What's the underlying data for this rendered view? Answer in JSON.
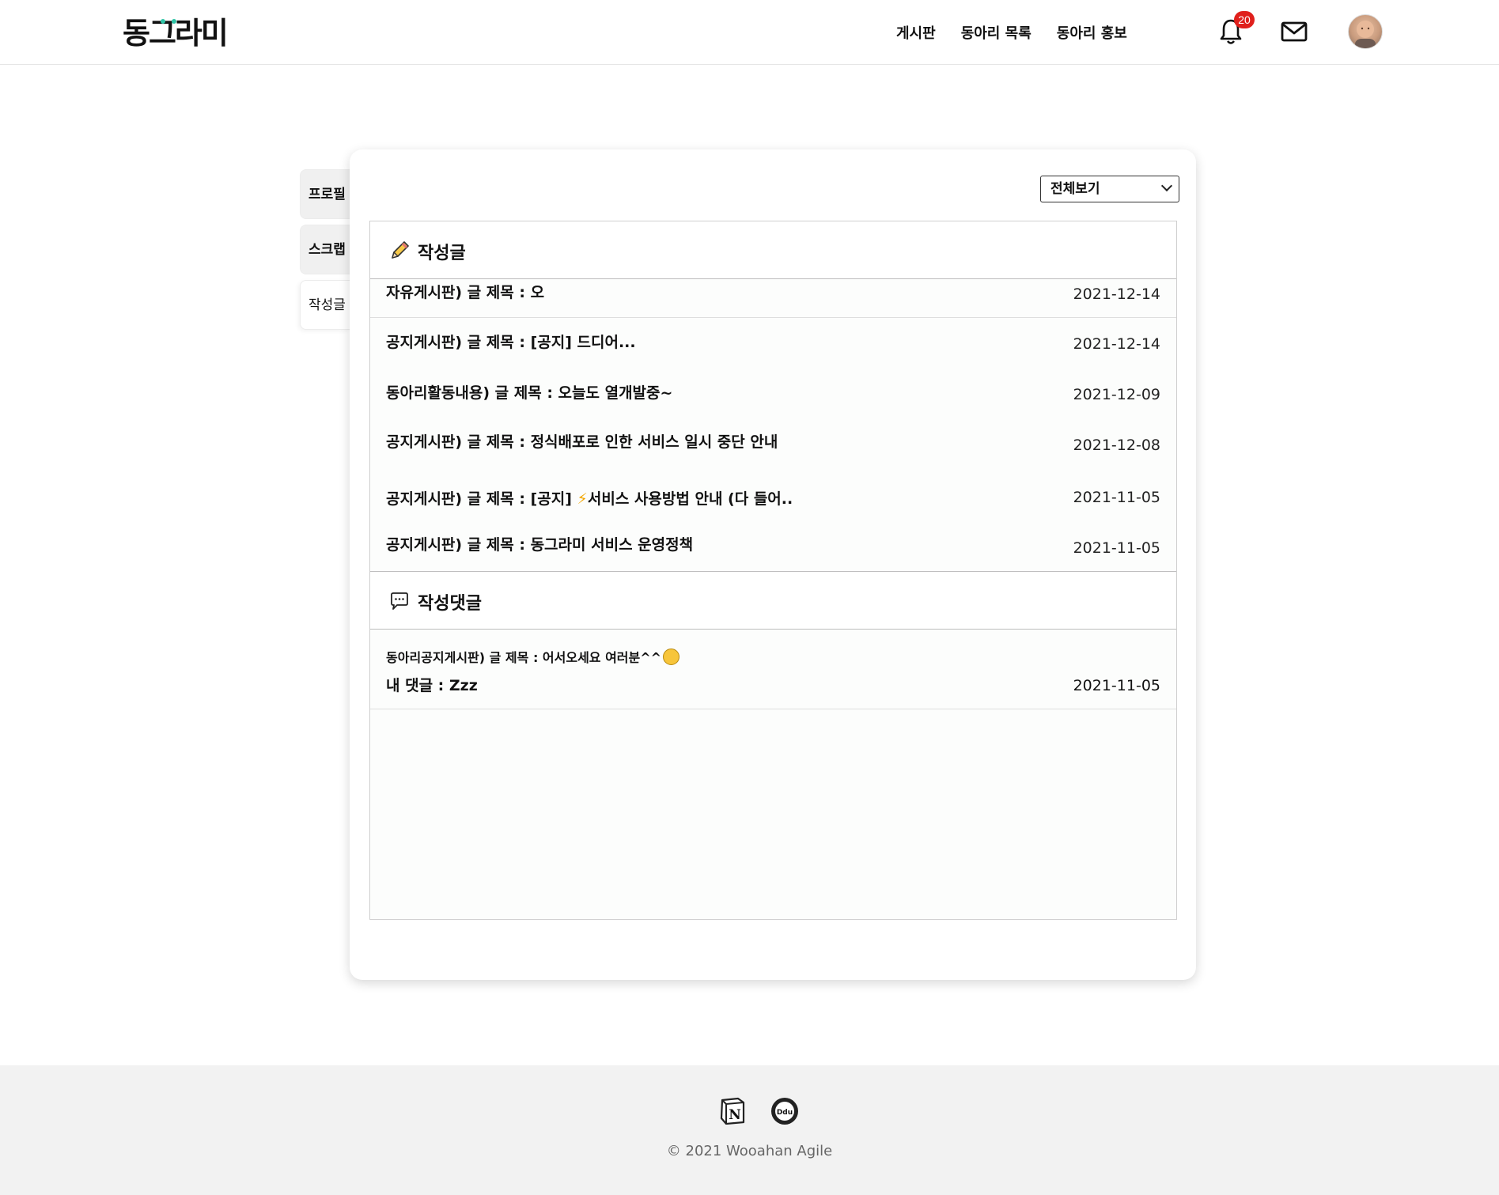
{
  "header": {
    "logo": "동그라미",
    "nav": [
      "게시판",
      "동아리 목록",
      "동아리 홍보"
    ],
    "notification_count": "20",
    "colors": {
      "badge": "#e0201c",
      "logo_dot": "#2ec4a6"
    }
  },
  "side_tabs": [
    {
      "label": "프로필",
      "active": false
    },
    {
      "label": "스크랩",
      "active": false
    },
    {
      "label": "작성글",
      "active": true
    }
  ],
  "filter": {
    "selected": "전체보기"
  },
  "posts_section": {
    "title": "작성글",
    "icon": "pencil-icon",
    "items": [
      {
        "title": "자유게시판) 글 제목 : 오",
        "date": "2021-12-14"
      },
      {
        "title": "공지게시판) 글 제목 : [공지] 드디어...",
        "date": "2021-12-14"
      },
      {
        "title": "동아리활동내용) 글 제목 : 오늘도 열개발중~",
        "date": "2021-12-09"
      },
      {
        "title": "공지게시판) 글 제목 : 정식배포로 인한 서비스 일시 중단 안내",
        "date": "2021-12-08"
      },
      {
        "title_prefix": "공지게시판) 글 제목 : [공지] ",
        "title_bolt": "⚡",
        "title_suffix": "서비스 사용방법 안내 (다 들어..",
        "date": "2021-11-05"
      },
      {
        "title": "공지게시판) 글 제목 : 동그라미 서비스 운영정책",
        "date": "2021-11-05"
      }
    ]
  },
  "comments_section": {
    "title": "작성댓글",
    "icon": "speech-bubble-icon",
    "items": [
      {
        "post": "동아리공지게시판) 글 제목 : 어서오세요 여러분^^",
        "comment": "내 댓글 : Zzz",
        "date": "2021-11-05"
      }
    ]
  },
  "footer": {
    "copyright": "© 2021 Wooahan Agile",
    "icons": [
      "notion-icon",
      "velog-icon"
    ]
  }
}
